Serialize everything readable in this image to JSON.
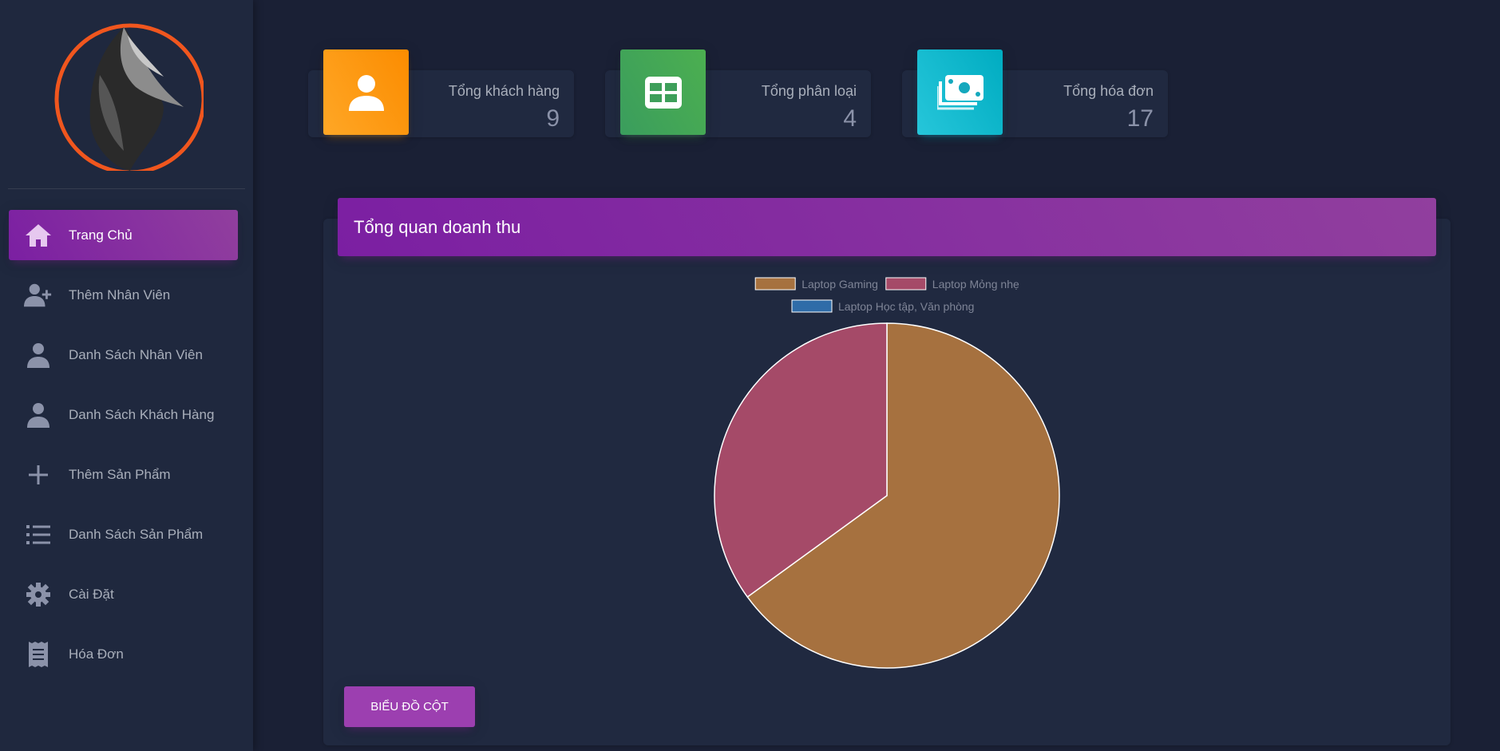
{
  "sidebar": {
    "items": [
      {
        "label": "Trang Chủ",
        "icon": "home-icon",
        "active": true
      },
      {
        "label": "Thêm Nhân Viên",
        "icon": "user-plus-icon",
        "active": false
      },
      {
        "label": "Danh Sách Nhân Viên",
        "icon": "user-icon",
        "active": false
      },
      {
        "label": "Danh Sách Khách Hàng",
        "icon": "user-icon",
        "active": false
      },
      {
        "label": "Thêm Sản Phẩm",
        "icon": "plus-icon",
        "active": false
      },
      {
        "label": "Danh Sách Sản Phẩm",
        "icon": "list-icon",
        "active": false
      },
      {
        "label": "Cài Đặt",
        "icon": "gear-icon",
        "active": false
      },
      {
        "label": "Hóa Đơn",
        "icon": "receipt-icon",
        "active": false
      }
    ]
  },
  "stats": [
    {
      "title": "Tổng khách hàng",
      "value": "9",
      "color": "#ff9800",
      "icon": "person-icon"
    },
    {
      "title": "Tổng phân loại",
      "value": "4",
      "color": "#43a047",
      "icon": "grid-icon"
    },
    {
      "title": "Tổng hóa đơn",
      "value": "17",
      "color": "#00acc1",
      "icon": "money-icon"
    }
  ],
  "revenue": {
    "title": "Tổng quan doanh thu",
    "button_label": "BIỂU ĐỒ CỘT"
  },
  "chart_data": {
    "type": "pie",
    "legend_position": "top",
    "series": [
      {
        "name": "Laptop Gaming",
        "value": 65,
        "color": "#a6713f"
      },
      {
        "name": "Laptop Mỏng nhẹ",
        "value": 35,
        "color": "#a54a68"
      },
      {
        "name": "Laptop Học tập, Văn phòng",
        "value": 0,
        "color": "#2f6ca8"
      }
    ]
  },
  "colors": {
    "accent": "#9c27b0",
    "background": "#1a2035",
    "card": "#202940",
    "sidebar": "#1f283e"
  }
}
